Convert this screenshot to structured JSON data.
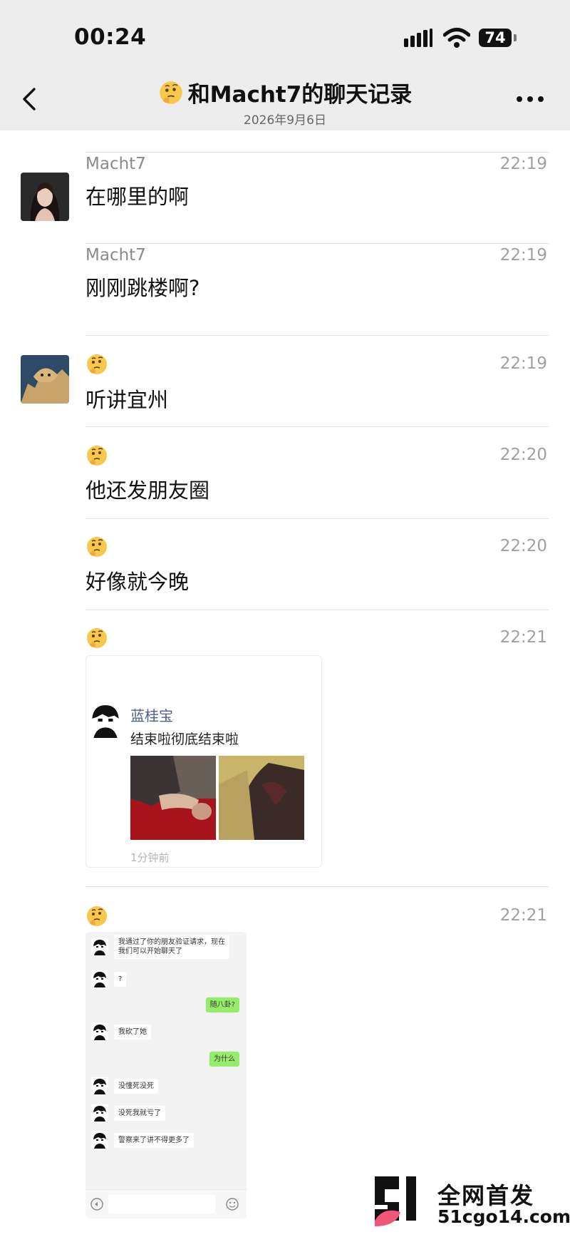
{
  "status_bar": {
    "time": "00:24",
    "battery": "74"
  },
  "header": {
    "title": "和Macht7的聊天记录",
    "subtitle": "2026年9月6日"
  },
  "messages": [
    {
      "sender": "Macht7",
      "time": "22:19",
      "text": "在哪里的啊"
    },
    {
      "sender": "Macht7",
      "time": "22:19",
      "text": "刚刚跳楼啊?"
    },
    {
      "sender_icon": "thinking-emoji",
      "time": "22:19",
      "text": "听讲宜州"
    },
    {
      "sender_icon": "thinking-emoji",
      "time": "22:20",
      "text": "他还发朋友圈"
    },
    {
      "sender_icon": "thinking-emoji",
      "time": "22:20",
      "text": "好像就今晚"
    },
    {
      "sender_icon": "thinking-emoji",
      "time": "22:21",
      "type": "image"
    },
    {
      "sender_icon": "thinking-emoji",
      "time": "22:21",
      "type": "image"
    }
  ],
  "moments_card": {
    "name": "蓝桂宝",
    "text": "结束啦彻底结束啦",
    "ago": "1分钟前"
  },
  "chat_screenshot": {
    "lines": [
      {
        "side": "left",
        "text": "我通过了你的朋友验证请求，现在我们可以开始聊天了"
      },
      {
        "side": "left",
        "text": "?"
      },
      {
        "side": "right",
        "text": "随八卦?"
      },
      {
        "side": "left",
        "text": "我砍了她"
      },
      {
        "side": "right",
        "text": "为什么"
      },
      {
        "side": "left",
        "text": "没懂死没死"
      },
      {
        "side": "left",
        "text": "没死我就亏了"
      },
      {
        "side": "left",
        "text": "警察来了讲不得更多了"
      }
    ]
  },
  "watermark": {
    "line1": "全网首发",
    "line2": "51cgo14.com"
  },
  "colors": {
    "bar_bg": "#ededed",
    "green_bubble": "#95ec69",
    "watermark_pink": "#f0567a"
  }
}
